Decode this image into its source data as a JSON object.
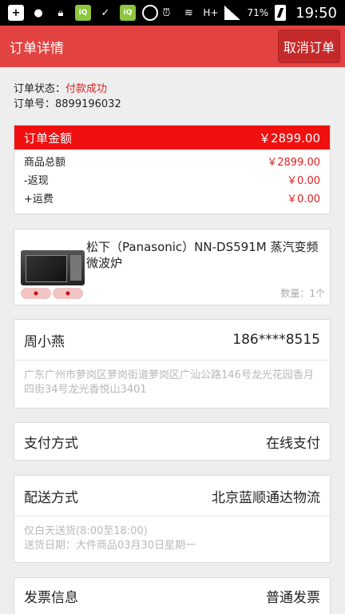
{
  "status_bar": {
    "time": "19:50",
    "battery": "71%",
    "network": "H+",
    "icons": [
      "plus-icon",
      "wechat-icon",
      "lock-icon",
      "iqiyi-icon",
      "check-icon",
      "iqiyi-icon",
      "circle-app-icon",
      "alarm-icon",
      "wifi-icon",
      "signal-icon",
      "battery-icon"
    ]
  },
  "header": {
    "title": "订单详情",
    "cancel_label": "取消订单"
  },
  "order": {
    "status_label": "订单状态：",
    "status_value": "付款成功",
    "number_label": "订单号：",
    "number_value": "8899196032"
  },
  "amount": {
    "title": "订单金额",
    "total": "￥2899.00",
    "rows": [
      {
        "label": "商品总额",
        "value": "￥2899.00"
      },
      {
        "label": "-返现",
        "value": "￥0.00"
      },
      {
        "label": "+运费",
        "value": "￥0.00"
      }
    ]
  },
  "product": {
    "name": "松下（Panasonic）NN-DS591M 蒸汽变频微波炉",
    "quantity": "数量：1个",
    "icon": "microwave-image"
  },
  "address": {
    "name": "周小燕",
    "phone": "186****8515",
    "text": "广东广州市萝岗区萝岗街道萝岗区广汕公路146号龙光花园香月四街34号龙光香悦山3401"
  },
  "payment": {
    "label": "支付方式",
    "value": "在线支付"
  },
  "shipping": {
    "label": "配送方式",
    "value": "北京蓝顺通达物流",
    "line1": "仅白天送货(8:00至18:00)",
    "line2": "送货日期：大件商品03月30日星期一"
  },
  "invoice": {
    "label": "发票信息",
    "value": "普通发票"
  },
  "colors": {
    "header": "#e34242",
    "amount_header": "#f01010",
    "accent_red": "#e02020"
  }
}
